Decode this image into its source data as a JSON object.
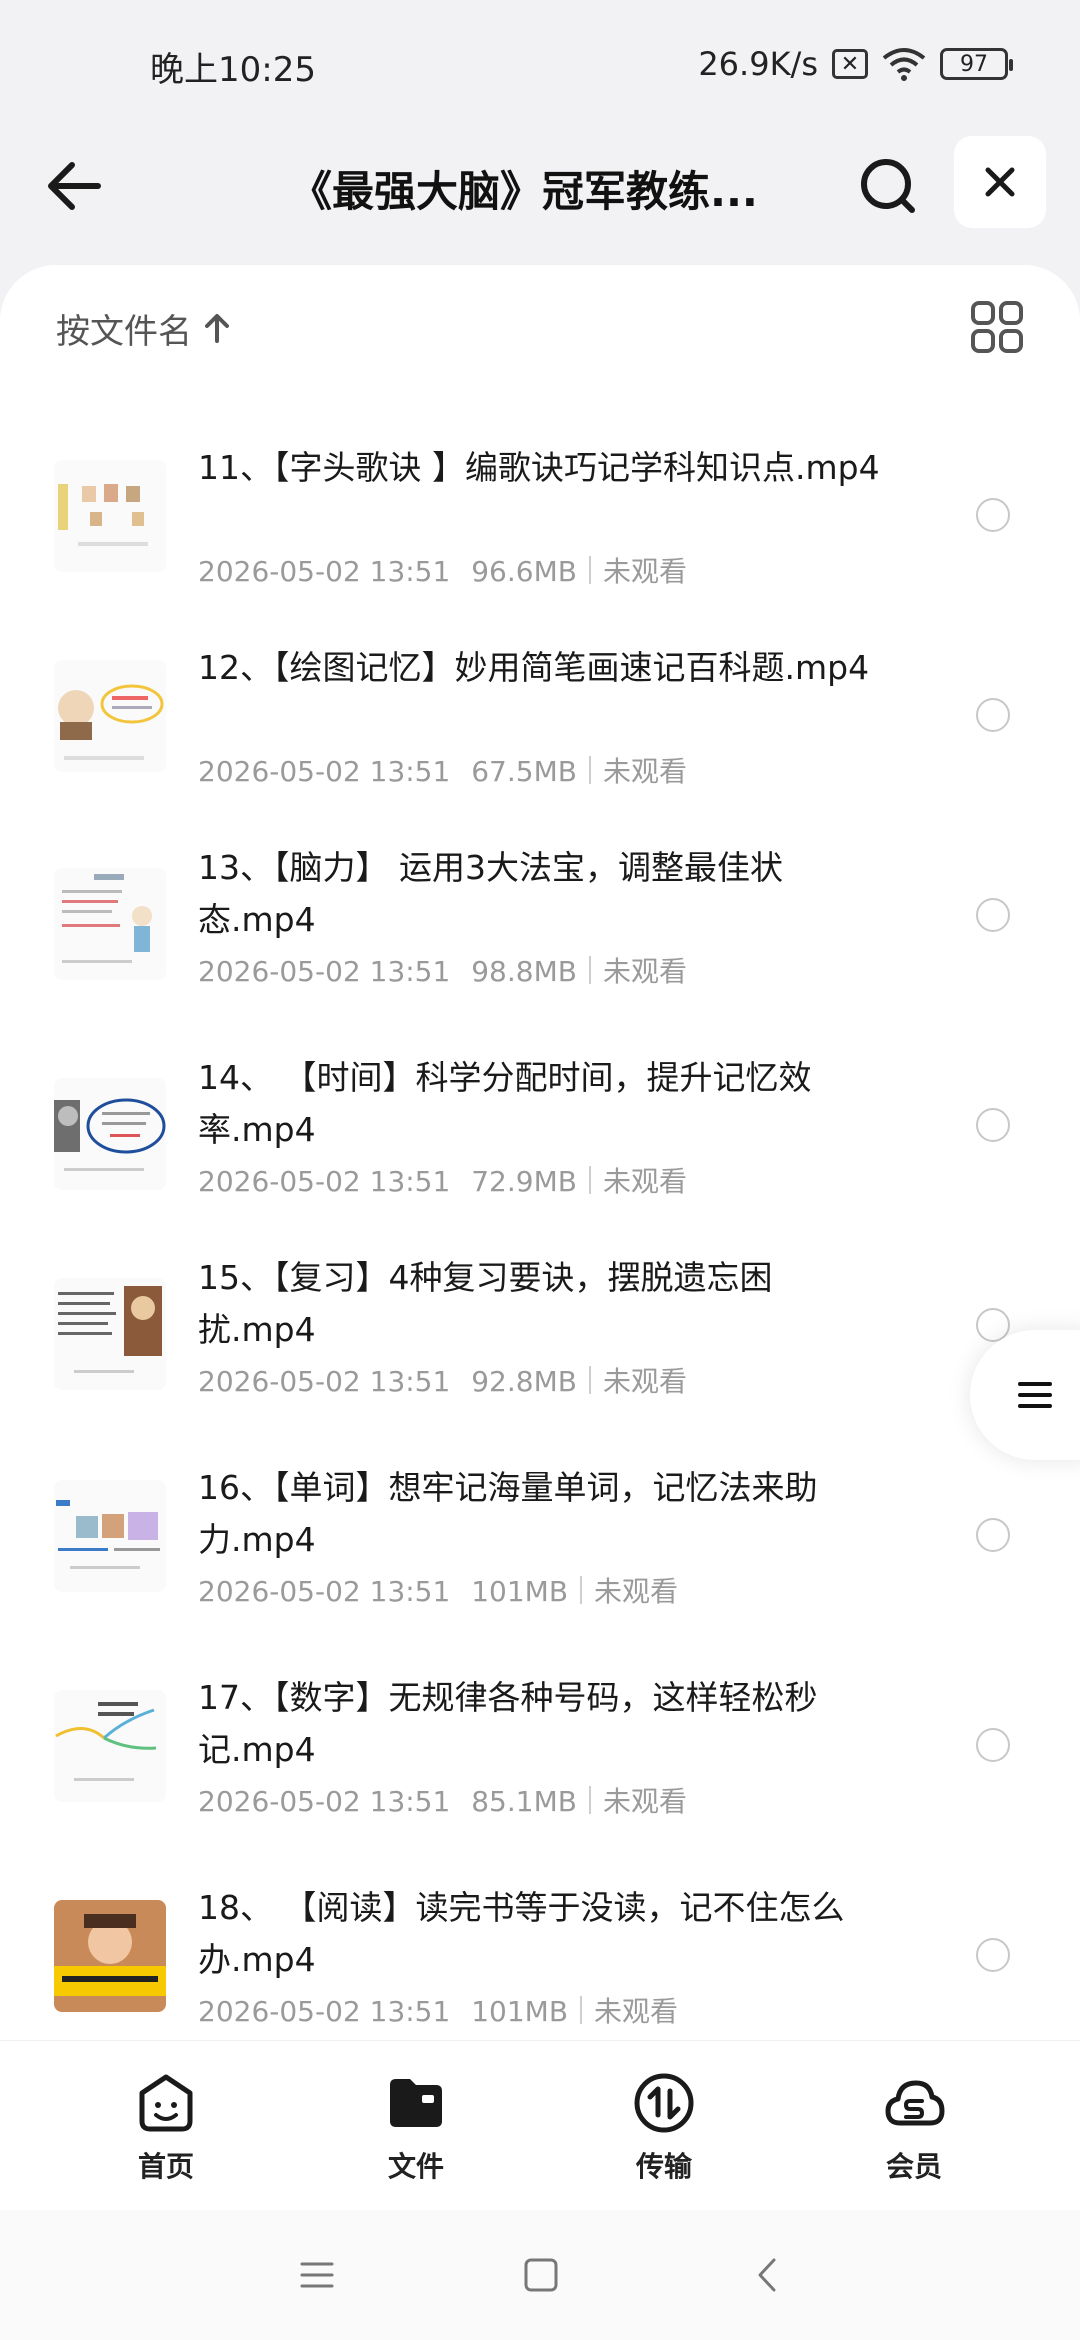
{
  "status": {
    "time": "晚上10:25",
    "network_speed": "26.9K/s",
    "battery": "97",
    "sim_icon": "x-icon",
    "wifi_icon": "wifi-icon"
  },
  "header": {
    "title": "《最强大脑》冠军教练...",
    "back_icon": "arrow-left-icon",
    "search_icon": "search-icon",
    "close_icon": "close-icon"
  },
  "toolbar": {
    "sort_label": "按文件名",
    "sort_icon": "arrow-up-icon",
    "view_icon": "grid-icon"
  },
  "files": [
    {
      "name": "11、【字头歌诀 】编歌诀巧记学科知识点.mp4",
      "date": "2026-05-02 13:51",
      "size": "96.6MB",
      "status": "未观看"
    },
    {
      "name": "12、【绘图记忆】妙用简笔画速记百科题.mp4",
      "date": "2026-05-02 13:51",
      "size": "67.5MB",
      "status": "未观看"
    },
    {
      "name": "13、【脑力】 运用3大法宝，调整最佳状态.mp4",
      "date": "2026-05-02 13:51",
      "size": "98.8MB",
      "status": "未观看"
    },
    {
      "name": "14、 【时间】科学分配时间，提升记忆效率.mp4",
      "date": "2026-05-02 13:51",
      "size": "72.9MB",
      "status": "未观看"
    },
    {
      "name": "15、【复习】4种复习要诀，摆脱遗忘困扰.mp4",
      "date": "2026-05-02 13:51",
      "size": "92.8MB",
      "status": "未观看"
    },
    {
      "name": "16、【单词】想牢记海量单词，记忆法来助力.mp4",
      "date": "2026-05-02 13:51",
      "size": "101MB",
      "status": "未观看"
    },
    {
      "name": "17、【数字】无规律各种号码，这样轻松秒记.mp4",
      "date": "2026-05-02 13:51",
      "size": "85.1MB",
      "status": "未观看"
    },
    {
      "name": "18、 【阅读】读完书等于没读，记不住怎么办.mp4",
      "date": "2026-05-02 13:51",
      "size": "101MB",
      "status": "未观看"
    }
  ],
  "nav": [
    {
      "label": "首页",
      "icon": "home-face-icon"
    },
    {
      "label": "文件",
      "icon": "folder-icon"
    },
    {
      "label": "传输",
      "icon": "transfer-icon"
    },
    {
      "label": "会员",
      "icon": "vip-cloud-icon"
    }
  ],
  "floating_menu_icon": "menu-icon",
  "system_nav": [
    "menu-icon",
    "home-square-icon",
    "back-chevron-icon"
  ]
}
